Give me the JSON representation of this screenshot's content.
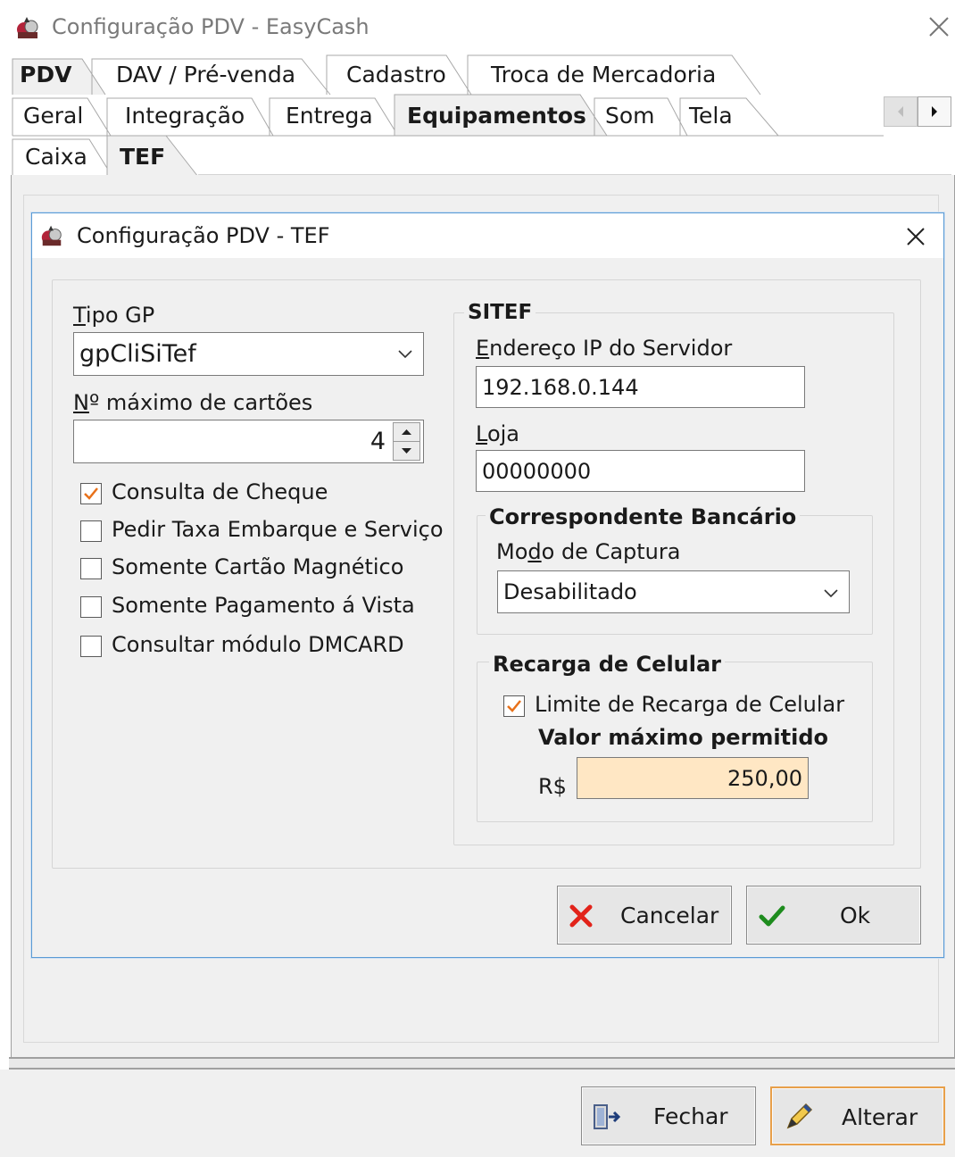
{
  "window": {
    "title": "Configuração PDV - EasyCash"
  },
  "tabs": {
    "row1": [
      {
        "label": "PDV",
        "active": true
      },
      {
        "label": "DAV / Pré-venda"
      },
      {
        "label": "Cadastro"
      },
      {
        "label": "Troca de Mercadoria"
      }
    ],
    "row2": [
      {
        "label": "Geral"
      },
      {
        "label": "Integração"
      },
      {
        "label": "Entrega"
      },
      {
        "label": "Equipamentos",
        "active": true
      },
      {
        "label": "Som"
      },
      {
        "label": "Tela"
      }
    ],
    "row3": [
      {
        "label": "Caixa"
      },
      {
        "label": "TEF",
        "active": true
      }
    ]
  },
  "dialog": {
    "title": "Configuração PDV - TEF",
    "tipo_gp": {
      "label_u": "T",
      "label_rest": "ipo GP",
      "value": "gpCliSiTef"
    },
    "max_cartoes": {
      "label_u": "N",
      "label_rest": "º máximo de cartões",
      "value": "4"
    },
    "checkboxes": [
      {
        "label": "Consulta de Cheque",
        "checked": true
      },
      {
        "label": "Pedir Taxa Embarque e Serviço",
        "checked": false
      },
      {
        "label": "Somente Cartão Magnético",
        "checked": false
      },
      {
        "label": "Somente Pagamento á Vista",
        "checked": false
      },
      {
        "label": "Consultar módulo DMCARD",
        "checked": false
      }
    ],
    "sitef": {
      "title": "SITEF",
      "ip_label_u": "E",
      "ip_label_rest": "ndereço IP do Servidor",
      "ip_value": "192.168.0.144",
      "loja_label_u": "L",
      "loja_label_rest": "oja",
      "loja_value": "00000000"
    },
    "correspondente": {
      "title": "Correspondente Bancário",
      "modo_label_pre": "Mo",
      "modo_label_u": "d",
      "modo_label_post": "o de Captura",
      "modo_value": "Desabilitado"
    },
    "recarga": {
      "title": "Recarga de Celular",
      "limite_label": "Limite de Recarga de Celular",
      "limite_checked": true,
      "valor_label": "Valor máximo permitido",
      "currency": "R$",
      "valor_value": "250,00"
    },
    "buttons": {
      "cancel": "Cancelar",
      "ok": "Ok"
    }
  },
  "footer": {
    "close": "Fechar",
    "edit": "Alterar"
  },
  "colors": {
    "accent": "#5b9bd5",
    "check": "#e8711a",
    "highlight_input": "#ffe7c4",
    "cancel_x": "#e2231a",
    "ok_check": "#1e8c1e"
  }
}
